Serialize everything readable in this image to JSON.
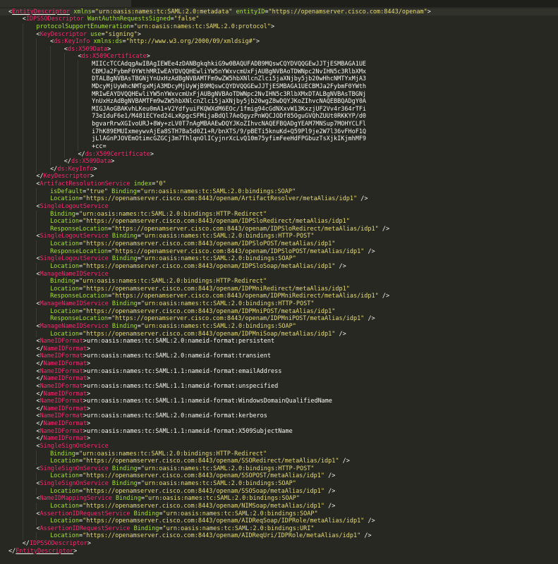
{
  "editor": {
    "language": "xml",
    "colors": {
      "background": "#272822",
      "tag": "#F92672",
      "attribute": "#A6E22E",
      "string": "#E6DB74",
      "text": "#F8F8F2"
    },
    "lines": [
      {
        "i": 0,
        "c": "<EntityDescriptor xmlns=\"urn:oasis:names:tc:SAML:2.0:metadata\" entityID=\"https://openamserver.cisco.com:8443/openam\">",
        "hl": true
      },
      {
        "i": 1,
        "c": "<IDPSSODescriptor WantAuthnRequestsSigned=\"false\""
      },
      {
        "i": 2,
        "c": "protocolSupportEnumeration=\"urn:oasis:names:tc:SAML:2.0:protocol\">"
      },
      {
        "i": 2,
        "c": "<KeyDescriptor use=\"signing\">"
      },
      {
        "i": 3,
        "c": "<ds:KeyInfo xmlns:ds=\"http://www.w3.org/2000/09/xmldsig#\">"
      },
      {
        "i": 4,
        "c": "<ds:X509Data>"
      },
      {
        "i": 5,
        "c": "<ds:X509Certificate>"
      },
      {
        "i": 6,
        "c": "MIICcTCCAdqgAwIBAgIEWEe4zDANBgkqhkiG9w0BAQUFADB9MQswCQYDVQQGEwJJTjESMBAGA1UE",
        "plain": true
      },
      {
        "i": 6,
        "c": "CBMJa2FybmF0YWthMRIwEAYDVQQHEwliYW5nYWxvcmUxFjAUBgNVBAoTDWNpc2NvIHN5c3RlbXMx",
        "plain": true
      },
      {
        "i": 6,
        "c": "DTALBgNVBAsTBGNjYnUxHzAdBgNVBAMTFm9wZW5hbXNlcnZlci5jaXNjby5jb20wHhcNMTYxMjA3",
        "plain": true
      },
      {
        "i": 6,
        "c": "MDcyMjUyWhcNMTgxMjA3MDcyMjUyWjB9MQswCQYDVQQGEwJJTjESMBAGA1UECBMJa2FybmF0YWth",
        "plain": true
      },
      {
        "i": 6,
        "c": "MRIwEAYDVQQHEwliYW5nYWxvcmUxFjAUBgNVBAoTDWNpc2NvIHN5c3RlbXMxDTALBgNVBAsTBGNj",
        "plain": true
      },
      {
        "i": 6,
        "c": "YnUxHzAdBgNVBAMTFm9wZW5hbXNlcnZlci5jaXNjby5jb20wgZ8wDQYJKoZIhvcNAQEBBQADgY0A",
        "plain": true
      },
      {
        "i": 6,
        "c": "MIGJAoGBAKvhLKeu0mA1+V2YdfyuiFKQWXdM6EOc/1fmig94cGdNXxvW13KxzjUF2Vv4r364rTFi",
        "plain": true
      },
      {
        "i": 6,
        "c": "73eIduF6e1/M481ECYed24LxKpgcSFMijaBdQl7AeQgyzPnWQCJODf85OguGVQhZUUt0RKKYP/d0",
        "plain": true
      },
      {
        "i": 6,
        "c": "bgvarRrwXGIvoURJ+8Wy+zLV0T7nAgMBAAEwDQYJKoZIhvcNAQEFBQADgYEAM7MNSup7MOHYCLFl",
        "plain": true
      },
      {
        "i": 6,
        "c": "i7hK89EMUIxmeywvAjEa8STH7Ba5d0Z1+R/bnXTS/9/pBETi5knuKd+Q59Pl9je2W7l36vFHoF1Q",
        "plain": true
      },
      {
        "i": 6,
        "c": "jLlAGnPJOVEmOtimcGZGCj3m7ThlqnOlICyjnrXcLvQ10m75yfimFeeHdFPGbuzTsXjkIKjmhMF9",
        "plain": true
      },
      {
        "i": 6,
        "c": "+cc=",
        "plain": true
      },
      {
        "i": 5,
        "c": "</ds:X509Certificate>"
      },
      {
        "i": 4,
        "c": "</ds:X509Data>"
      },
      {
        "i": 3,
        "c": "</ds:KeyInfo>"
      },
      {
        "i": 2,
        "c": "</KeyDescriptor>"
      },
      {
        "i": 2,
        "c": "<ArtifactResolutionService index=\"0\""
      },
      {
        "i": 3,
        "c": "isDefault=\"true\" Binding=\"urn:oasis:names:tc:SAML:2.0:bindings:SOAP\""
      },
      {
        "i": 3,
        "c": "Location=\"https://openamserver.cisco.com:8443/openam/ArtifactResolver/metaAlias/idp1\" />"
      },
      {
        "i": 2,
        "c": "<SingleLogoutService"
      },
      {
        "i": 3,
        "c": "Binding=\"urn:oasis:names:tc:SAML:2.0:bindings:HTTP-Redirect\""
      },
      {
        "i": 3,
        "c": "Location=\"https://openamserver.cisco.com:8443/openam/IDPSloRedirect/metaAlias/idp1\""
      },
      {
        "i": 3,
        "c": "ResponseLocation=\"https://openamserver.cisco.com:8443/openam/IDPSloRedirect/metaAlias/idp1\" />"
      },
      {
        "i": 2,
        "c": "<SingleLogoutService Binding=\"urn:oasis:names:tc:SAML:2.0:bindings:HTTP-POST\""
      },
      {
        "i": 3,
        "c": "Location=\"https://openamserver.cisco.com:8443/openam/IDPSloPOST/metaAlias/idp1\""
      },
      {
        "i": 3,
        "c": "ResponseLocation=\"https://openamserver.cisco.com:8443/openam/IDPSloPOST/metaAlias/idp1\" />"
      },
      {
        "i": 2,
        "c": "<SingleLogoutService Binding=\"urn:oasis:names:tc:SAML:2.0:bindings:SOAP\""
      },
      {
        "i": 3,
        "c": "Location=\"https://openamserver.cisco.com:8443/openam/IDPSloSoap/metaAlias/idp1\" />"
      },
      {
        "i": 2,
        "c": "<ManageNameIDService"
      },
      {
        "i": 3,
        "c": "Binding=\"urn:oasis:names:tc:SAML:2.0:bindings:HTTP-Redirect\""
      },
      {
        "i": 3,
        "c": "Location=\"https://openamserver.cisco.com:8443/openam/IDPMniRedirect/metaAlias/idp1\""
      },
      {
        "i": 3,
        "c": "ResponseLocation=\"https://openamserver.cisco.com:8443/openam/IDPMniRedirect/metaAlias/idp1\" />"
      },
      {
        "i": 2,
        "c": "<ManageNameIDService Binding=\"urn:oasis:names:tc:SAML:2.0:bindings:HTTP-POST\""
      },
      {
        "i": 3,
        "c": "Location=\"https://openamserver.cisco.com:8443/openam/IDPMniPOST/metaAlias/idp1\""
      },
      {
        "i": 3,
        "c": "ResponseLocation=\"https://openamserver.cisco.com:8443/openam/IDPMniPOST/metaAlias/idp1\" />"
      },
      {
        "i": 2,
        "c": "<ManageNameIDService Binding=\"urn:oasis:names:tc:SAML:2.0:bindings:SOAP\""
      },
      {
        "i": 3,
        "c": "Location=\"https://openamserver.cisco.com:8443/openam/IDPMniSoap/metaAlias/idp1\" />"
      },
      {
        "i": 2,
        "c": "<NameIDFormat>urn:oasis:names:tc:SAML:2.0:nameid-format:persistent"
      },
      {
        "i": 2,
        "c": "</NameIDFormat>"
      },
      {
        "i": 2,
        "c": "<NameIDFormat>urn:oasis:names:tc:SAML:2.0:nameid-format:transient"
      },
      {
        "i": 2,
        "c": "</NameIDFormat>"
      },
      {
        "i": 2,
        "c": "<NameIDFormat>urn:oasis:names:tc:SAML:1.1:nameid-format:emailAddress"
      },
      {
        "i": 2,
        "c": "</NameIDFormat>"
      },
      {
        "i": 2,
        "c": "<NameIDFormat>urn:oasis:names:tc:SAML:1.1:nameid-format:unspecified"
      },
      {
        "i": 2,
        "c": "</NameIDFormat>"
      },
      {
        "i": 2,
        "c": "<NameIDFormat>urn:oasis:names:tc:SAML:1.1:nameid-format:WindowsDomainQualifiedName"
      },
      {
        "i": 2,
        "c": "</NameIDFormat>"
      },
      {
        "i": 2,
        "c": "<NameIDFormat>urn:oasis:names:tc:SAML:2.0:nameid-format:kerberos"
      },
      {
        "i": 2,
        "c": "</NameIDFormat>"
      },
      {
        "i": 2,
        "c": "<NameIDFormat>urn:oasis:names:tc:SAML:1.1:nameid-format:X509SubjectName"
      },
      {
        "i": 2,
        "c": "</NameIDFormat>"
      },
      {
        "i": 2,
        "c": "<SingleSignOnService"
      },
      {
        "i": 3,
        "c": "Binding=\"urn:oasis:names:tc:SAML:2.0:bindings:HTTP-Redirect\""
      },
      {
        "i": 3,
        "c": "Location=\"https://openamserver.cisco.com:8443/openam/SSORedirect/metaAlias/idp1\" />"
      },
      {
        "i": 2,
        "c": "<SingleSignOnService Binding=\"urn:oasis:names:tc:SAML:2.0:bindings:HTTP-POST\""
      },
      {
        "i": 3,
        "c": "Location=\"https://openamserver.cisco.com:8443/openam/SSOPOST/metaAlias/idp1\" />"
      },
      {
        "i": 2,
        "c": "<SingleSignOnService Binding=\"urn:oasis:names:tc:SAML:2.0:bindings:SOAP\""
      },
      {
        "i": 3,
        "c": "Location=\"https://openamserver.cisco.com:8443/openam/SSOSoap/metaAlias/idp1\" />"
      },
      {
        "i": 2,
        "c": "<NameIDMappingService Binding=\"urn:oasis:names:tc:SAML:2.0:bindings:SOAP\""
      },
      {
        "i": 3,
        "c": "Location=\"https://openamserver.cisco.com:8443/openam/NIMSoap/metaAlias/idp1\" />"
      },
      {
        "i": 2,
        "c": "<AssertionIDRequestService Binding=\"urn:oasis:names:tc:SAML:2.0:bindings:SOAP\""
      },
      {
        "i": 3,
        "c": "Location=\"https://openamserver.cisco.com:8443/openam/AIDReqSoap/IDPRole/metaAlias/idp1\" />"
      },
      {
        "i": 2,
        "c": "<AssertionIDRequestService Binding=\"urn:oasis:names:tc:SAML:2.0:bindings:URI\""
      },
      {
        "i": 3,
        "c": "Location=\"https://openamserver.cisco.com:8443/openam/AIDReqUri/IDPRole/metaAlias/idp1\" />"
      },
      {
        "i": 1,
        "c": "</IDPSSODescriptor>"
      },
      {
        "i": 0,
        "c": "</EntityDescriptor>"
      }
    ]
  }
}
